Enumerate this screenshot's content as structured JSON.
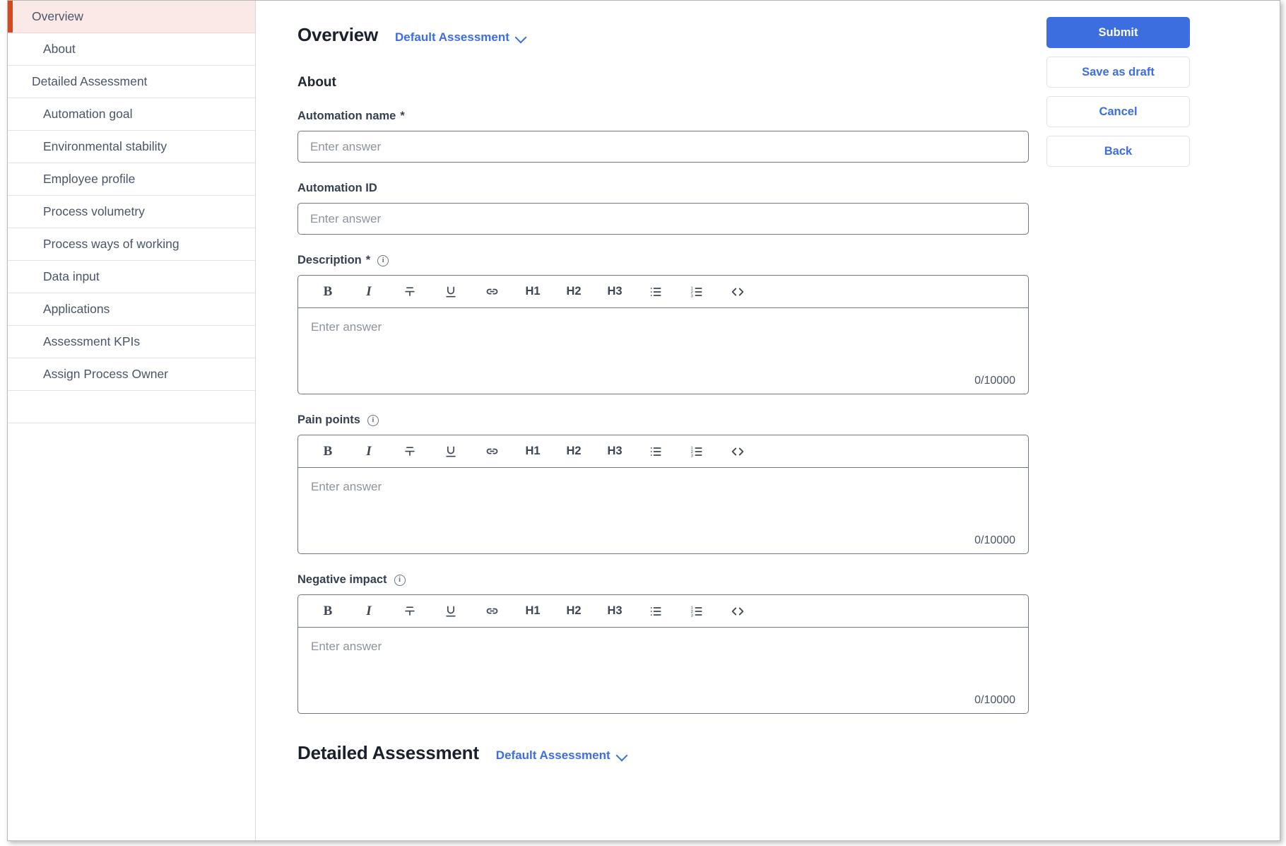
{
  "sidebar": {
    "items": [
      {
        "label": "Overview",
        "level": 0,
        "active": true
      },
      {
        "label": "About",
        "level": 1,
        "active": false
      },
      {
        "label": "Detailed Assessment",
        "level": 0,
        "active": false
      },
      {
        "label": "Automation goal",
        "level": 1,
        "active": false
      },
      {
        "label": "Environmental stability",
        "level": 1,
        "active": false
      },
      {
        "label": "Employee profile",
        "level": 1,
        "active": false
      },
      {
        "label": "Process volumetry",
        "level": 1,
        "active": false
      },
      {
        "label": "Process ways of working",
        "level": 1,
        "active": false
      },
      {
        "label": "Data input",
        "level": 1,
        "active": false
      },
      {
        "label": "Applications",
        "level": 1,
        "active": false
      },
      {
        "label": "Assessment KPIs",
        "level": 1,
        "active": false
      },
      {
        "label": "Assign Process Owner",
        "level": 1,
        "active": false
      }
    ],
    "active_accent_color": "#d4491e",
    "active_background_color": "#fbe9e7"
  },
  "header": {
    "title": "Overview",
    "assessment_selector": "Default Assessment"
  },
  "about_section": {
    "title": "About",
    "fields": [
      {
        "label": "Automation name",
        "required": "*",
        "has_info": false,
        "type": "text",
        "value": "",
        "placeholder": "Enter answer"
      },
      {
        "label": "Automation ID",
        "required": "",
        "has_info": false,
        "type": "text",
        "value": "",
        "placeholder": "Enter answer"
      },
      {
        "label": "Description",
        "required": "*",
        "has_info": true,
        "type": "richtext",
        "value": "",
        "placeholder": "Enter answer",
        "counter": "0/10000"
      },
      {
        "label": "Pain points",
        "required": "",
        "has_info": true,
        "type": "richtext",
        "value": "",
        "placeholder": "Enter answer",
        "counter": "0/10000"
      },
      {
        "label": "Negative impact",
        "required": "",
        "has_info": true,
        "type": "richtext",
        "value": "",
        "placeholder": "Enter answer",
        "counter": "0/10000"
      }
    ]
  },
  "editor_toolbar": {
    "buttons": [
      {
        "name": "bold",
        "label": "B",
        "kind": "bold"
      },
      {
        "name": "italic",
        "label": "I",
        "kind": "italic"
      },
      {
        "name": "strikethrough",
        "label": "",
        "kind": "strike"
      },
      {
        "name": "underline",
        "label": "",
        "kind": "underline"
      },
      {
        "name": "link",
        "label": "",
        "kind": "link"
      },
      {
        "name": "heading-1",
        "label": "H1",
        "kind": "head"
      },
      {
        "name": "heading-2",
        "label": "H2",
        "kind": "head"
      },
      {
        "name": "heading-3",
        "label": "H3",
        "kind": "head"
      },
      {
        "name": "bullet-list",
        "label": "",
        "kind": "ul"
      },
      {
        "name": "numbered-list",
        "label": "",
        "kind": "ol"
      },
      {
        "name": "code-block",
        "label": "",
        "kind": "code"
      }
    ]
  },
  "actions": {
    "submit": "Submit",
    "save_draft": "Save as draft",
    "cancel": "Cancel",
    "back": "Back",
    "primary_color": "#3c6ee0"
  },
  "detailed_assessment": {
    "title": "Detailed Assessment",
    "assessment_selector": "Default Assessment"
  },
  "info_glyph": "i"
}
